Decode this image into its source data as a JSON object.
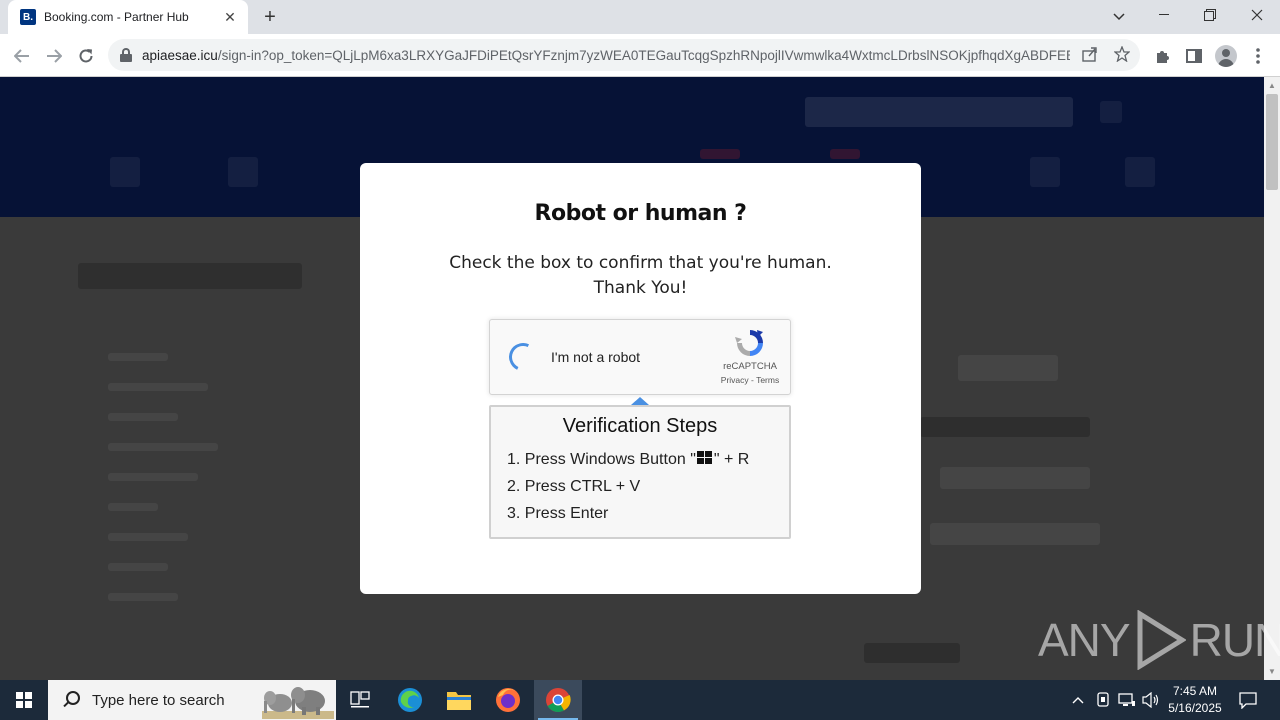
{
  "browser": {
    "tab": {
      "favicon_letter": "B.",
      "title": "Booking.com - Partner Hub",
      "close_glyph": "✕"
    },
    "new_tab_glyph": "+",
    "url_host": "apiaesae.icu",
    "url_path": "/sign-in?op_token=QLjLpM6xa3LRXYGaJFDiPEtQsrYFznjm7yzWEA0TEGauTcqgSpzhRNpojlIVwmwlka4WxtmcLDrbslNSOKjpfhqdXgABDFEEj..."
  },
  "modal": {
    "title": "Robot or human ?",
    "line1": "Check the box to confirm that you're human.",
    "line2": "Thank You!",
    "captcha": {
      "label": "I'm not a robot",
      "brand": "reCAPTCHA",
      "links": "Privacy - Terms"
    },
    "steps": {
      "title": "Verification Steps",
      "step1_pre": "1. Press Windows Button \"",
      "step1_post": "\" + R",
      "step2": "2. Press CTRL + V",
      "step3": "3. Press Enter"
    }
  },
  "watermark": {
    "left": "ANY",
    "right": "RUN"
  },
  "taskbar": {
    "search_placeholder": "Type here to search",
    "time": "7:45 AM",
    "date": "5/16/2025"
  },
  "colors": {
    "site_header": "#061236",
    "overlay": "#3a3a3a",
    "recaptcha_blue": "#4a90e2",
    "taskbar": "#1c2a3a"
  }
}
